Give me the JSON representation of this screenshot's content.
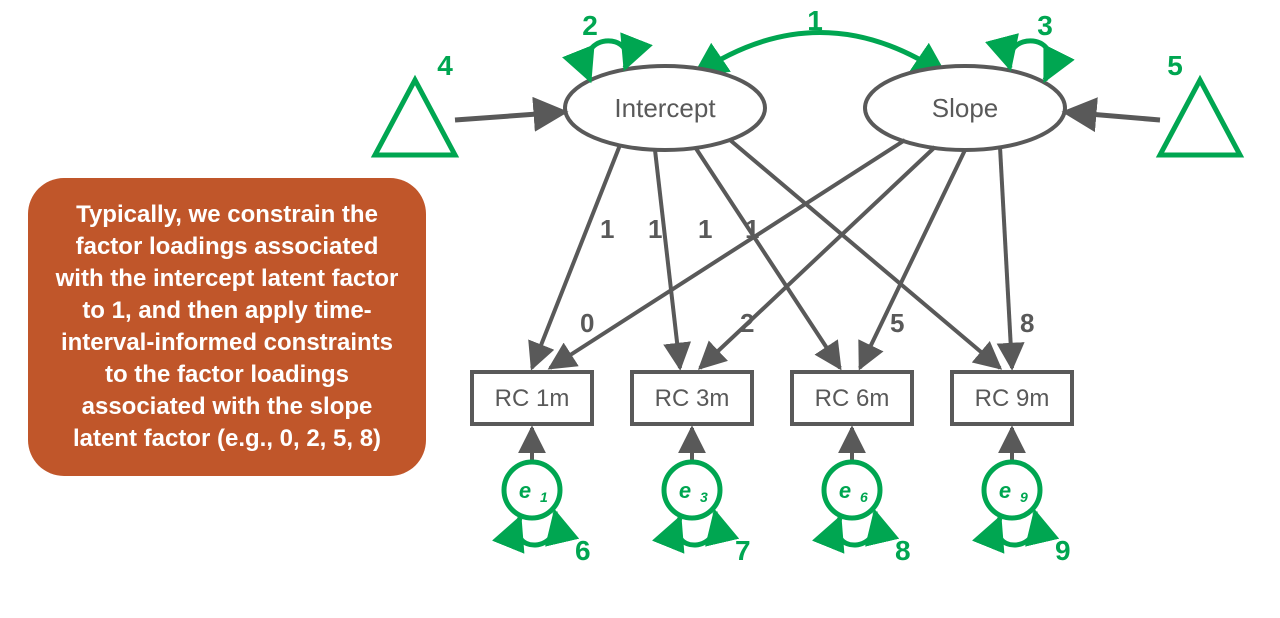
{
  "latent": {
    "intercept": "Intercept",
    "slope": "Slope"
  },
  "loadings": {
    "intercept": [
      "1",
      "1",
      "1",
      "1"
    ],
    "slope": [
      "0",
      "2",
      "5",
      "8"
    ]
  },
  "observed": [
    "RC 1m",
    "RC 3m",
    "RC 6m",
    "RC 9m"
  ],
  "errors": {
    "labels": [
      "e",
      "e",
      "e",
      "e"
    ],
    "subs": [
      "1",
      "3",
      "6",
      "9"
    ]
  },
  "annot": {
    "cov": "1",
    "var_intercept": "2",
    "var_slope": "3",
    "tri_left": "4",
    "tri_right": "5",
    "err_nums": [
      "6",
      "7",
      "8",
      "9"
    ]
  },
  "callout": [
    "Typically, we constrain the",
    "factor loadings associated",
    "with the intercept latent factor",
    "to 1, and then apply time-",
    "interval-informed constraints",
    "to the factor loadings",
    "associated with the slope",
    "latent factor (e.g., 0, 2, 5, 8)"
  ],
  "colors": {
    "green": "#00a651",
    "gray": "#595959",
    "callout": "#c0562a"
  }
}
